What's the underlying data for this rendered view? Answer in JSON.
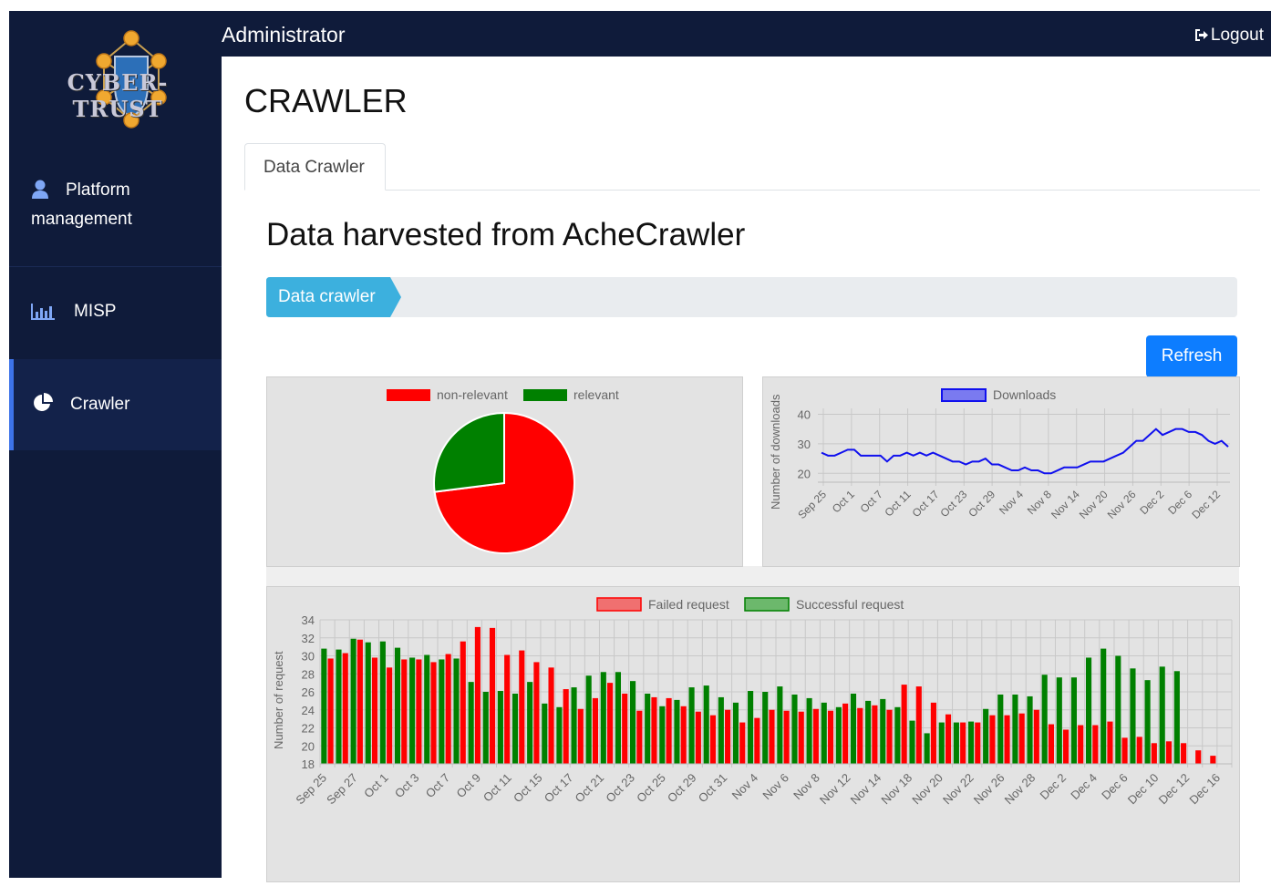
{
  "brand": {
    "logo_text": "CYBER-TRUST"
  },
  "sidebar": {
    "items": [
      {
        "label": "Platform management",
        "label_line1": "Platform",
        "label_line2": "management",
        "icon": "user-icon"
      },
      {
        "label": "MISP",
        "icon": "bar-chart-icon"
      },
      {
        "label": "Crawler",
        "icon": "pie-chart-icon",
        "active": true
      }
    ]
  },
  "topbar": {
    "title": "Administrator",
    "logout_label": "Logout"
  },
  "page": {
    "title": "CRAWLER",
    "tabs": [
      {
        "label": "Data Crawler",
        "active": true
      }
    ],
    "section_title": "Data harvested from AcheCrawler",
    "breadcrumb": {
      "item": "Data crawler"
    },
    "refresh_label": "Refresh"
  },
  "colors": {
    "sidebar_bg": "#0f1b3a",
    "accent": "#3d73e8",
    "breadcrumb_active": "#3cb0de",
    "button": "#0d7dff"
  },
  "chart_data": [
    {
      "type": "pie",
      "legend": [
        "non-relevant",
        "relevant"
      ],
      "colors": [
        "#ff0000",
        "#008000"
      ],
      "values": [
        73,
        27
      ]
    },
    {
      "type": "line",
      "series": [
        {
          "name": "Downloads",
          "color": "#1010ee",
          "values": [
            27,
            26,
            26,
            27,
            28,
            28,
            26,
            26,
            26,
            26,
            24,
            26,
            26,
            27,
            26,
            27,
            26,
            27,
            26,
            25,
            24,
            24,
            23,
            24,
            24,
            25,
            23,
            23,
            22,
            21,
            21,
            22,
            21,
            21,
            20,
            20,
            21,
            22,
            22,
            22,
            23,
            24,
            24,
            24,
            25,
            26,
            27,
            29,
            31,
            31,
            33,
            35,
            33,
            34,
            35,
            35,
            34,
            34,
            33,
            31,
            30,
            31,
            29
          ]
        }
      ],
      "ylabel": "Number of downloads",
      "ylim": [
        17,
        42
      ],
      "yticks": [
        20,
        30,
        40
      ],
      "xtick_labels": [
        "Sep 25",
        "Oct 1",
        "Oct 7",
        "Oct 11",
        "Oct 17",
        "Oct 23",
        "Oct 29",
        "Nov 4",
        "Nov 8",
        "Nov 14",
        "Nov 20",
        "Nov 26",
        "Dec 2",
        "Dec 6",
        "Dec 12"
      ]
    },
    {
      "type": "bar",
      "series": [
        {
          "name": "Failed request",
          "color": "#ff0000",
          "values": [
            29.7,
            30.3,
            31.8,
            29.8,
            28.7,
            29.6,
            29.6,
            29.3,
            30.2,
            31.6,
            33.2,
            33.1,
            30.1,
            30.6,
            29.3,
            28.7,
            26.3,
            24.1,
            25.3,
            27.0,
            25.8,
            23.9,
            25.4,
            25.3,
            24.4,
            23.8,
            23.4,
            24.0,
            22.6,
            23.1,
            24.0,
            23.9,
            23.8,
            24.1,
            23.9,
            24.7,
            24.2,
            24.5,
            24.0,
            26.8,
            26.6,
            24.8,
            23.5,
            22.6,
            22.6,
            23.4,
            23.4,
            23.6,
            24.0,
            22.4,
            21.8,
            22.3,
            22.3,
            22.7,
            20.9,
            21.0,
            20.3,
            20.5,
            20.3,
            19.5,
            18.9
          ],
          "labels": "not printed"
        },
        {
          "name": "Successful request",
          "color": "#008000",
          "values": [
            30.8,
            30.7,
            31.9,
            31.5,
            31.6,
            30.9,
            29.8,
            30.1,
            29.6,
            29.7,
            27.1,
            26.0,
            26.1,
            25.8,
            27.1,
            24.7,
            24.3,
            26.5,
            27.8,
            28.2,
            28.2,
            27.2,
            25.8,
            24.4,
            25.1,
            26.5,
            26.7,
            25.4,
            24.8,
            26.1,
            26.0,
            26.6,
            25.7,
            25.3,
            24.8,
            24.3,
            25.8,
            25.0,
            25.2,
            24.3,
            22.8,
            21.4,
            22.6,
            22.6,
            22.7,
            24.1,
            25.7,
            25.7,
            25.5,
            27.9,
            27.6,
            27.6,
            29.8,
            30.8,
            30.0,
            28.6,
            27.3,
            28.8,
            28.3
          ]
        }
      ],
      "ylabel": "Number of request",
      "ylim": [
        18,
        34
      ],
      "yticks": [
        18,
        20,
        22,
        24,
        26,
        28,
        30,
        32,
        34
      ],
      "xtick_labels": [
        "Sep 25",
        "Sep 27",
        "Oct 1",
        "Oct 3",
        "Oct 7",
        "Oct 9",
        "Oct 11",
        "Oct 15",
        "Oct 17",
        "Oct 21",
        "Oct 23",
        "Oct 25",
        "Oct 29",
        "Oct 31",
        "Nov 4",
        "Nov 6",
        "Nov 8",
        "Nov 12",
        "Nov 14",
        "Nov 18",
        "Nov 20",
        "Nov 22",
        "Nov 26",
        "Nov 28",
        "Dec 2",
        "Dec 4",
        "Dec 6",
        "Dec 10",
        "Dec 12",
        "Dec 16"
      ]
    }
  ]
}
